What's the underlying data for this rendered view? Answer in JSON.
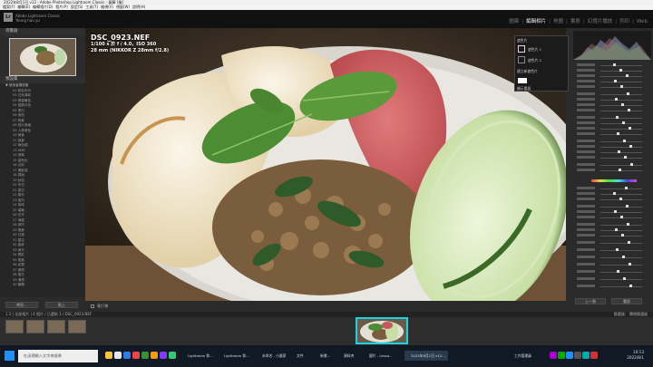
{
  "window": {
    "title": "2022年8月1日 v12 - Adobe Photoshop Lightroom Classic - 圖庫 [檢]"
  },
  "menu": [
    "檔案(F)",
    "編輯(E)",
    "編輯相片(D)",
    "相片(P)",
    "設定(S)",
    "工具(T)",
    "檢視(V)",
    "視窗(W)",
    "說明(H)"
  ],
  "identity": {
    "app": "Adobe Lightroom Classic",
    "user": "Yeung hau yu"
  },
  "modules": [
    {
      "label": "圖庫",
      "active": false
    },
    {
      "label": "編輯相片",
      "active": true
    },
    {
      "label": "地圖",
      "active": false
    },
    {
      "label": "書冊",
      "active": false
    },
    {
      "label": "幻燈片播放",
      "active": false
    },
    {
      "label": "列印",
      "active": false
    },
    {
      "label": "Web",
      "active": false
    }
  ],
  "left_panel": {
    "navigator_label": "導覽器",
    "presets_label": "預設集",
    "preset_items": [
      {
        "label": "▼ 使用者預設集",
        "group": true
      },
      {
        "label": "01 粉色系列",
        "group": false
      },
      {
        "label": "02 日系清新",
        "group": false
      },
      {
        "label": "03 黃昏暖色",
        "group": false
      },
      {
        "label": "04 藍調冷色",
        "group": false
      },
      {
        "label": "05 黑白",
        "group": false
      },
      {
        "label": "06 街拍",
        "group": false
      },
      {
        "label": "07 夜景",
        "group": false
      },
      {
        "label": "08 底片風格",
        "group": false
      },
      {
        "label": "09 人像膚色",
        "group": false
      },
      {
        "label": "10 美食",
        "group": false
      },
      {
        "label": "11 風景",
        "group": false
      },
      {
        "label": "12 綠色調",
        "group": false
      },
      {
        "label": "13 HDR",
        "group": false
      },
      {
        "label": "14 懷舊",
        "group": false
      },
      {
        "label": "15 高對比",
        "group": false
      },
      {
        "label": "16 淡彩",
        "group": false
      },
      {
        "label": "17 電影感",
        "group": false
      },
      {
        "label": "18 霧面",
        "group": false
      },
      {
        "label": "19 秋色",
        "group": false
      },
      {
        "label": "20 冬日",
        "group": false
      },
      {
        "label": "21 夏日",
        "group": false
      },
      {
        "label": "22 春天",
        "group": false
      },
      {
        "label": "23 室內",
        "group": false
      },
      {
        "label": "24 咖啡",
        "group": false
      },
      {
        "label": "25 建築",
        "group": false
      },
      {
        "label": "26 花卉",
        "group": false
      },
      {
        "label": "27 海邊",
        "group": false
      },
      {
        "label": "28 城市",
        "group": false
      },
      {
        "label": "29 雪景",
        "group": false
      },
      {
        "label": "30 日落",
        "group": false
      },
      {
        "label": "31 星空",
        "group": false
      },
      {
        "label": "32 森林",
        "group": false
      },
      {
        "label": "33 雨天",
        "group": false
      },
      {
        "label": "34 霓虹",
        "group": false
      },
      {
        "label": "35 柔焦",
        "group": false
      },
      {
        "label": "36 紀實",
        "group": false
      },
      {
        "label": "37 極簡",
        "group": false
      },
      {
        "label": "38 復古",
        "group": false
      },
      {
        "label": "39 清透",
        "group": false
      },
      {
        "label": "40 暖陽",
        "group": false
      }
    ],
    "copy_button": "拷貝...",
    "paste_button": "貼上"
  },
  "photo_info": {
    "filename": "DSC_0923.NEF",
    "exposure": "1/100 s 於 f / 4.0，ISO 360",
    "lens": "28 mm (NIKKOR Z 28mm f/2.8)"
  },
  "toolbar": {
    "label": "軟打樣"
  },
  "masks_panel": {
    "title": "遮色片",
    "items": [
      "遮色片 1",
      "遮色片 2"
    ],
    "add_label": "建立新遮色片",
    "show_overlay": "顯示重疊"
  },
  "right_panel": {
    "reset_button": "重設",
    "previous_button": "上一張"
  },
  "filmstrip_bar": {
    "path": "1  2  |  全部相片  |  4 相片 / 已選取 1 / DSC_0923.NEF",
    "filename": "DSC_0923.NEF",
    "filter_label": "篩選器：",
    "filter_value": "關閉篩選器"
  },
  "taskbar": {
    "search_placeholder": "在這裡輸入文字來搜尋",
    "apps": [
      {
        "label": "Lightroom 和..."
      },
      {
        "label": "Lightroom 和..."
      },
      {
        "label": "未命名 - 小畫家"
      },
      {
        "label": "文件"
      },
      {
        "label": "新增..."
      },
      {
        "label": "資料夾"
      },
      {
        "label": "圖片 - Lesso..."
      },
      {
        "label": "2022年8月1日 v12..."
      },
      {
        "label": "工作管理員"
      }
    ],
    "time": "10:13",
    "date": "2022/8/1"
  }
}
